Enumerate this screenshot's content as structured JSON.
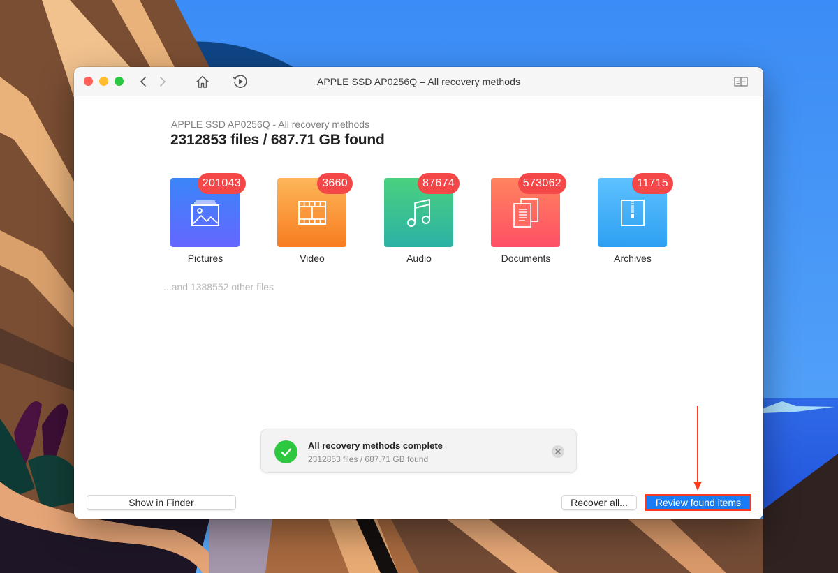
{
  "window": {
    "title": "APPLE SSD AP0256Q – All recovery methods",
    "toolbar": {
      "back_icon": "chevron-left-icon",
      "forward_icon": "chevron-right-icon",
      "home_icon": "home-icon",
      "resume_icon": "resume-scan-icon",
      "sidebar_icon": "book-sidebar-icon"
    }
  },
  "summary": {
    "subtitle": "APPLE SSD AP0256Q - All recovery methods",
    "headline": "2312853 files / 687.71 GB found"
  },
  "categories": [
    {
      "label": "Pictures",
      "count": "201043",
      "icon": "picture-icon"
    },
    {
      "label": "Video",
      "count": "3660",
      "icon": "film-icon"
    },
    {
      "label": "Audio",
      "count": "87674",
      "icon": "music-note-icon"
    },
    {
      "label": "Documents",
      "count": "573062",
      "icon": "documents-icon"
    },
    {
      "label": "Archives",
      "count": "11715",
      "icon": "zip-archive-icon"
    }
  ],
  "other_files": "...and 1388552 other files",
  "toast": {
    "title": "All recovery methods complete",
    "subtitle": "2312853 files / 687.71 GB found",
    "status_icon": "checkmark-icon",
    "close_icon": "close-icon"
  },
  "buttons": {
    "show_in_finder": "Show in Finder",
    "recover_all": "Recover all...",
    "review_found_items": "Review found items"
  },
  "colors": {
    "badge": "#f44848",
    "primary_button": "#1a7cf5",
    "annotation": "#ff3b1f",
    "success": "#2ec840"
  }
}
